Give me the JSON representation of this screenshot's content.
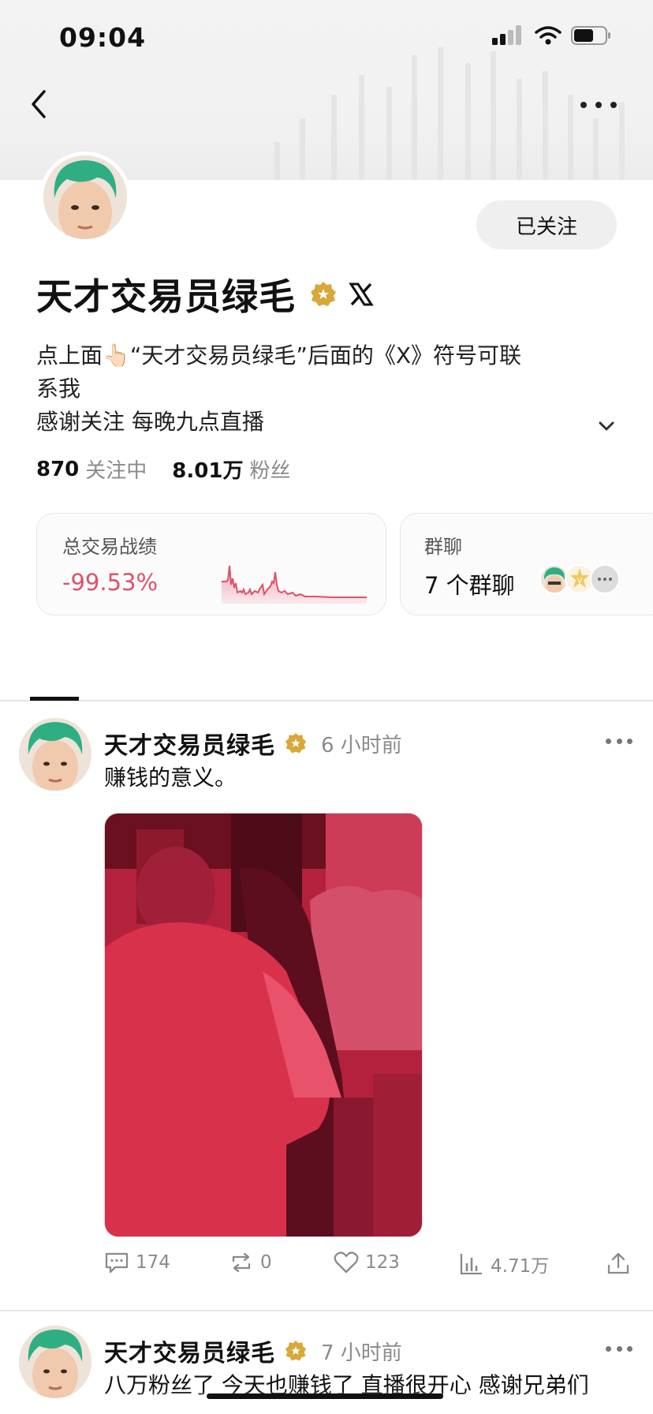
{
  "status_bar": {
    "time": "09:04"
  },
  "profile": {
    "name": "天才交易员绿毛",
    "follow_button": "已关注",
    "bio_lines": [
      "点上面👆🏻“天才交易员绿毛”后面的《X》符号可联",
      "系我",
      "感谢关注 每晚九点直播"
    ],
    "following_count": "870",
    "following_label": "关注中",
    "followers_count": "8.01万",
    "followers_label": "粉丝"
  },
  "cards": {
    "trade": {
      "title": "总交易战绩",
      "value": "-99.53%"
    },
    "group": {
      "title": "群聊",
      "value": "7 个群聊"
    }
  },
  "posts": [
    {
      "author": "天才交易员绿毛",
      "time": "6 小时前",
      "text": "赚钱的意义。",
      "comments": "174",
      "reposts": "0",
      "likes": "123",
      "views": "4.71万"
    },
    {
      "author": "天才交易员绿毛",
      "time": "7 小时前",
      "text": "八万粉丝了 今天也赚钱了 直播很开心 感谢兄弟们"
    }
  ],
  "colors": {
    "negative": "#e0506a",
    "verified": "#d8a838",
    "accent_text": "#111111"
  },
  "icons": [
    "back-icon",
    "more-icon",
    "verified-badge-icon",
    "x-logo-icon",
    "chevron-down-icon",
    "comment-icon",
    "repost-icon",
    "like-icon",
    "views-icon",
    "share-icon"
  ]
}
